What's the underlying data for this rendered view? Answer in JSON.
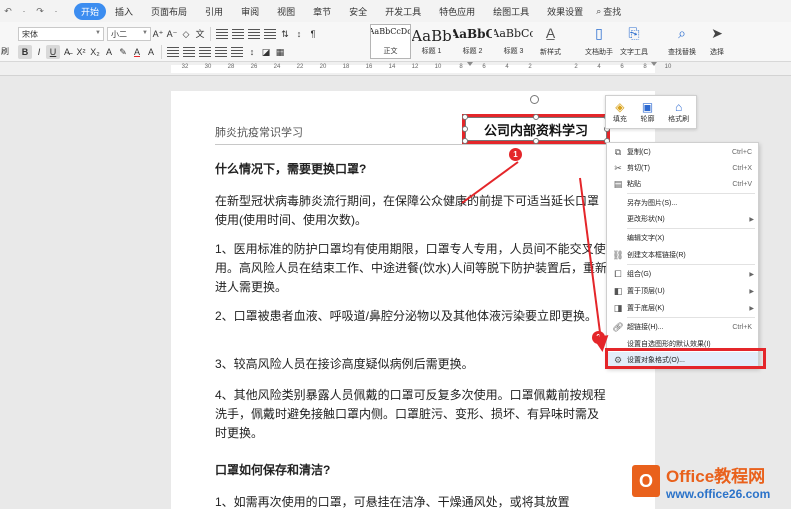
{
  "quick_access": [
    "↶",
    "·",
    "↷",
    "·"
  ],
  "tabs": [
    {
      "label": "开始",
      "active": true
    },
    {
      "label": "插入"
    },
    {
      "label": "页面布局"
    },
    {
      "label": "引用"
    },
    {
      "label": "审阅"
    },
    {
      "label": "视图"
    },
    {
      "label": "章节"
    },
    {
      "label": "安全"
    },
    {
      "label": "开发工具"
    },
    {
      "label": "特色应用"
    },
    {
      "label": "绘图工具"
    },
    {
      "label": "效果设置"
    }
  ],
  "search_label": "查找",
  "toolbar": {
    "font_name": "宋体",
    "font_size": "小二",
    "styles": [
      {
        "preview": "AaBbCcDd",
        "name": "正文"
      },
      {
        "preview": "AaBb",
        "name": "标题 1"
      },
      {
        "preview": "AaBbC",
        "name": "标题 2"
      },
      {
        "preview": "AaBbCc",
        "name": "标题 3"
      }
    ],
    "new_style": "新样式",
    "text_tools": "文字工具",
    "text_assistant": "文档助手",
    "find_replace": "查找替换",
    "select": "选择",
    "left_cut_label": "刷"
  },
  "ruler_ticks": [
    "32",
    "30",
    "28",
    "26",
    "24",
    "22",
    "20",
    "18",
    "16",
    "14",
    "12",
    "10",
    "8",
    "6",
    "4",
    "2",
    "",
    "2",
    "4",
    "6",
    "8",
    "10"
  ],
  "document": {
    "header": "肺炎抗疫常识学习",
    "textbox": "公司内部资料学习",
    "paragraphs": [
      {
        "text": "什么情况下，需要更换口罩?",
        "bold": true
      },
      {
        "text": "在新型冠状病毒肺炎流行期间，在保障公众健康的前提下可适当延长口罩使用(使用时间、使用次数)。"
      },
      {
        "text": "1、医用标准的防护口罩均有使用期限，口罩专人专用，人员间不能交叉使用。高风险人员在结束工作、中途进餐(饮水)人间等脱下防护装置后，重新进人需更换。"
      },
      {
        "text": "2、口罩被患者血液、呼吸道/鼻腔分泌物以及其他体液污染要立即更换。"
      },
      {
        "text": "3、较高风险人员在接诊高度疑似病例后需更换。"
      },
      {
        "text": "4、其他风险类别暴露人员佩戴的口罩可反复多次使用。口罩佩戴前按规程洗手，佩戴时避免接触口罩内侧。口罩脏污、变形、损坏、有异味时需及时更换。"
      },
      {
        "text": "口罩如何保存和清洁?",
        "bold": true
      },
      {
        "text": "1、如需再次使用的口罩，可悬挂在洁净、干燥通风处，或将其放置"
      }
    ]
  },
  "float_toolbar": [
    {
      "label": "填充",
      "icon": "fill-icon"
    },
    {
      "label": "轮廓",
      "icon": "outline-icon"
    },
    {
      "label": "格式刷",
      "icon": "format-brush-icon"
    }
  ],
  "context_menu": [
    {
      "label": "复制(C)",
      "shortcut": "Ctrl+C",
      "icon": "copy-icon"
    },
    {
      "label": "剪切(T)",
      "shortcut": "Ctrl+X",
      "icon": "cut-icon"
    },
    {
      "label": "粘贴",
      "shortcut": "Ctrl+V",
      "icon": "paste-icon"
    },
    {
      "label": "另存为图片(S)...",
      "icon": ""
    },
    {
      "label": "更改形状(N)",
      "submenu": true,
      "icon": ""
    },
    {
      "label": "编辑文字(X)",
      "icon": ""
    },
    {
      "label": "创建文本框链接(R)",
      "icon": "link-icon"
    },
    {
      "label": "组合(G)",
      "submenu": true,
      "icon": "group-icon"
    },
    {
      "label": "置于顶层(U)",
      "submenu": true,
      "icon": "bring-front-icon"
    },
    {
      "label": "置于底层(K)",
      "submenu": true,
      "icon": "send-back-icon"
    },
    {
      "label": "超链接(H)...",
      "shortcut": "Ctrl+K",
      "icon": "hyperlink-icon"
    },
    {
      "label": "设置自选图形的默认效果(I)",
      "icon": ""
    },
    {
      "label": "设置对象格式(O)...",
      "icon": "format-object-icon",
      "highlight": true
    }
  ],
  "badges": [
    "1",
    "2"
  ],
  "watermark": {
    "logo": "O",
    "title": "Office教程网",
    "url": "www.office26.com"
  },
  "colors": {
    "accent": "#3c8df0",
    "highlight": "#e4262a",
    "watermark": "#e9611c"
  }
}
